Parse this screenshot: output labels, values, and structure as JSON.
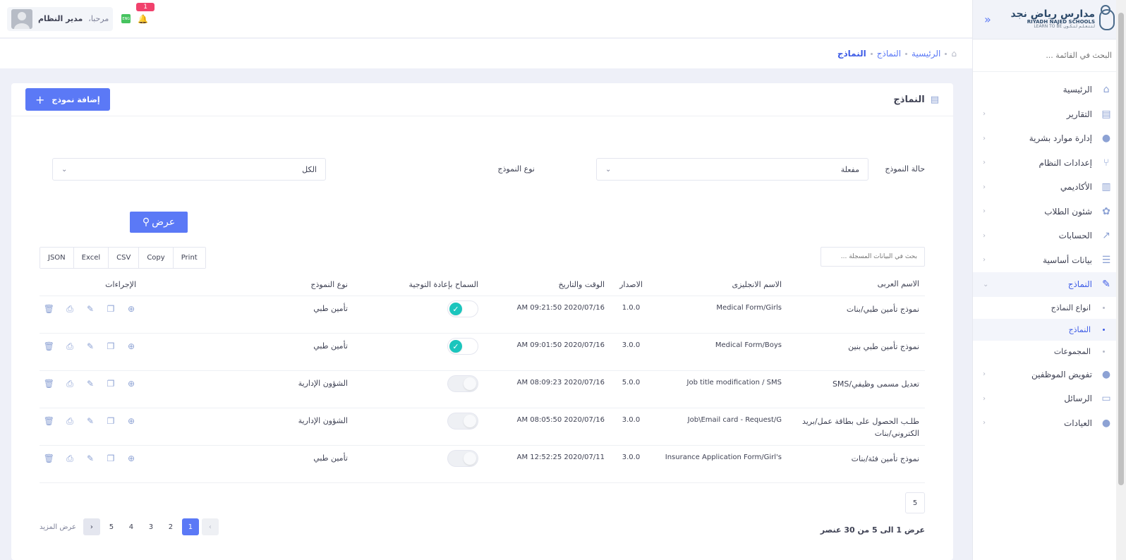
{
  "brand": {
    "name_ar": "مدارس رياض نجد",
    "name_en": "RIYADH NAJED SCHOOLS",
    "tagline": "LEARN TO BE لـتـتـعـلـم لـتـكـون"
  },
  "sidebar": {
    "search_placeholder": "البحث في القائمة ...",
    "items": [
      {
        "label": "الرئيسية",
        "icon": "home-icon",
        "has_arrow": false
      },
      {
        "label": "التقارير",
        "icon": "report-icon",
        "has_arrow": true
      },
      {
        "label": "إدارة موارد بشرية",
        "icon": "user-icon",
        "has_arrow": true
      },
      {
        "label": "إعدادات النظام",
        "icon": "branch-icon",
        "has_arrow": true
      },
      {
        "label": "الأكاديمي",
        "icon": "book-icon",
        "has_arrow": true
      },
      {
        "label": "شئون الطلاب",
        "icon": "group-icon",
        "has_arrow": true
      },
      {
        "label": "الحسابات",
        "icon": "chart-icon",
        "has_arrow": true
      },
      {
        "label": "بيانات أساسية",
        "icon": "database-icon",
        "has_arrow": true
      },
      {
        "label": "النماذج",
        "icon": "form-icon",
        "has_arrow": true,
        "active": true
      }
    ],
    "sub_items": [
      {
        "label": "انواع النماذج"
      },
      {
        "label": "النماذج",
        "active": true
      },
      {
        "label": "المجموعات"
      }
    ],
    "items_after": [
      {
        "label": "تفويض الموظفين",
        "icon": "user-plus-icon",
        "has_arrow": true
      },
      {
        "label": "الرسائل",
        "icon": "message-icon",
        "has_arrow": true
      },
      {
        "label": "العيادات",
        "icon": "clinic-icon",
        "has_arrow": true
      }
    ]
  },
  "topbar": {
    "greeting": "مرحبا،",
    "user_name": "مدير النظام",
    "lang_badge": "ENG",
    "notification_count": "1"
  },
  "breadcrumb": {
    "items": [
      "الرئيسية",
      "النماذج",
      "النماذج"
    ]
  },
  "card": {
    "title": "النماذج",
    "add_button": "إضافة نموذج"
  },
  "filters": {
    "status_label": "حالة النموذج",
    "status_value": "مفعلة",
    "type_label": "نوع النموذج",
    "type_value": "الكل",
    "show_button": "عرض"
  },
  "export": [
    "JSON",
    "Excel",
    "CSV",
    "Copy",
    "Print"
  ],
  "table_search_placeholder": "بحث في البيانات المسجلة ...",
  "table": {
    "headers": {
      "name_ar": "الاسم العربى",
      "name_en": "الاسم الانجليزى",
      "version": "الاصدار",
      "datetime": "الوقت والتاريخ",
      "redirect": "السماح بإعادة التوجية",
      "type": "نوع النموذج",
      "actions": "الإجراءات"
    },
    "rows": [
      {
        "name_ar": "نموذج تأمين طبي/بنات",
        "name_en": "Medical Form/Girls",
        "version": "1.0.0",
        "datetime": "AM 09:21:50 2020/07/16",
        "redirect": true,
        "type": "تأمين طبي"
      },
      {
        "name_ar": "نموذج تأمين طبي بنين",
        "name_en": "Medical Form/Boys",
        "version": "3.0.0",
        "datetime": "AM 09:01:50 2020/07/16",
        "redirect": true,
        "type": "تأمين طبي"
      },
      {
        "name_ar": "تعديل مسمى وظيفي/SMS",
        "name_en": "Job title modification / SMS",
        "version": "5.0.0",
        "datetime": "AM 08:09:23 2020/07/16",
        "redirect": false,
        "type": "الشؤون الإدارية"
      },
      {
        "name_ar": "طلـب الحصول على بطاقة عمل/بريد الكتروني/بنات",
        "name_en": "Job\\Email card - Request/G",
        "version": "3.0.0",
        "datetime": "AM 08:05:50 2020/07/16",
        "redirect": false,
        "type": "الشؤون الإدارية"
      },
      {
        "name_ar": "نموذج تأمين فئة/بنات",
        "name_en": "Insurance Application Form/Girl's",
        "version": "3.0.0",
        "datetime": "AM 12:52:25 2020/07/11",
        "redirect": false,
        "type": "تأمين طبي"
      }
    ]
  },
  "pagination": {
    "page_size": "5",
    "info": "عرض 1 الى 5 من 30 عنصر",
    "pages": [
      "1",
      "2",
      "3",
      "4",
      "5"
    ],
    "active_page": "1",
    "more": "عرض المزيد"
  }
}
